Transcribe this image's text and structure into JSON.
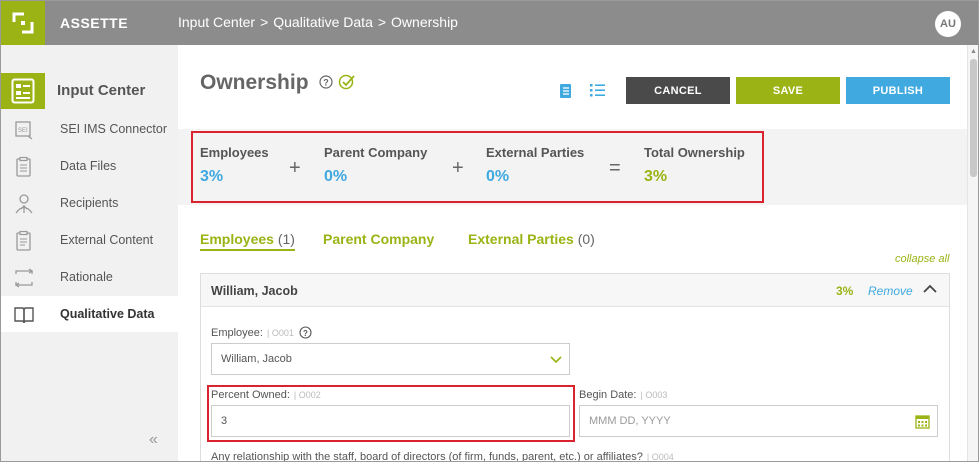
{
  "header": {
    "app_name": "ASSETTE",
    "breadcrumb": [
      "Input Center",
      ">",
      "Qualitative Data",
      ">",
      "Ownership"
    ],
    "avatar": "AU"
  },
  "sidebar": {
    "title": "Input Center",
    "items": [
      {
        "label": "SEI IMS Connector",
        "icon": "sei-connector-icon"
      },
      {
        "label": "Data Files",
        "icon": "data-files-icon"
      },
      {
        "label": "Recipients",
        "icon": "recipients-icon"
      },
      {
        "label": "External Content",
        "icon": "external-content-icon"
      },
      {
        "label": "Rationale",
        "icon": "rationale-icon"
      },
      {
        "label": "Qualitative Data",
        "icon": "book-icon",
        "active": true
      }
    ],
    "collapse_glyph": "«"
  },
  "page": {
    "title": "Ownership",
    "buttons": {
      "cancel": "CANCEL",
      "save": "SAVE",
      "publish": "PUBLISH"
    }
  },
  "summary": {
    "employees": {
      "label": "Employees",
      "value": "3%"
    },
    "op1": "+",
    "parent": {
      "label": "Parent Company",
      "value": "0%"
    },
    "op2": "+",
    "external": {
      "label": "External Parties",
      "value": "0%"
    },
    "op3": "=",
    "total": {
      "label": "Total Ownership",
      "value": "3%"
    }
  },
  "tabs": [
    {
      "label": "Employees",
      "count": "(1)",
      "active": true
    },
    {
      "label": "Parent Company",
      "count": ""
    },
    {
      "label": "External Parties",
      "count": "(0)"
    }
  ],
  "collapse_all": "collapse all",
  "record": {
    "name": "William, Jacob",
    "percent": "3%",
    "remove": "Remove",
    "employee_label": "Employee:",
    "employee_code": "| O001",
    "employee_value": "William, Jacob",
    "percent_label": "Percent Owned:",
    "percent_code": "| O002",
    "percent_value": "3",
    "begin_label": "Begin Date:",
    "begin_code": "| O003",
    "begin_placeholder": "MMM DD, YYYY",
    "question": "Any relationship with the staff, board of directors (of firm, funds, parent, etc.) or affiliates?",
    "question_code": "| O004"
  },
  "colors": {
    "brand_green": "#9bb315",
    "accent_blue": "#3fa9e0",
    "highlight_red": "#d9232e",
    "topbar_gray": "#8c8c8c"
  }
}
